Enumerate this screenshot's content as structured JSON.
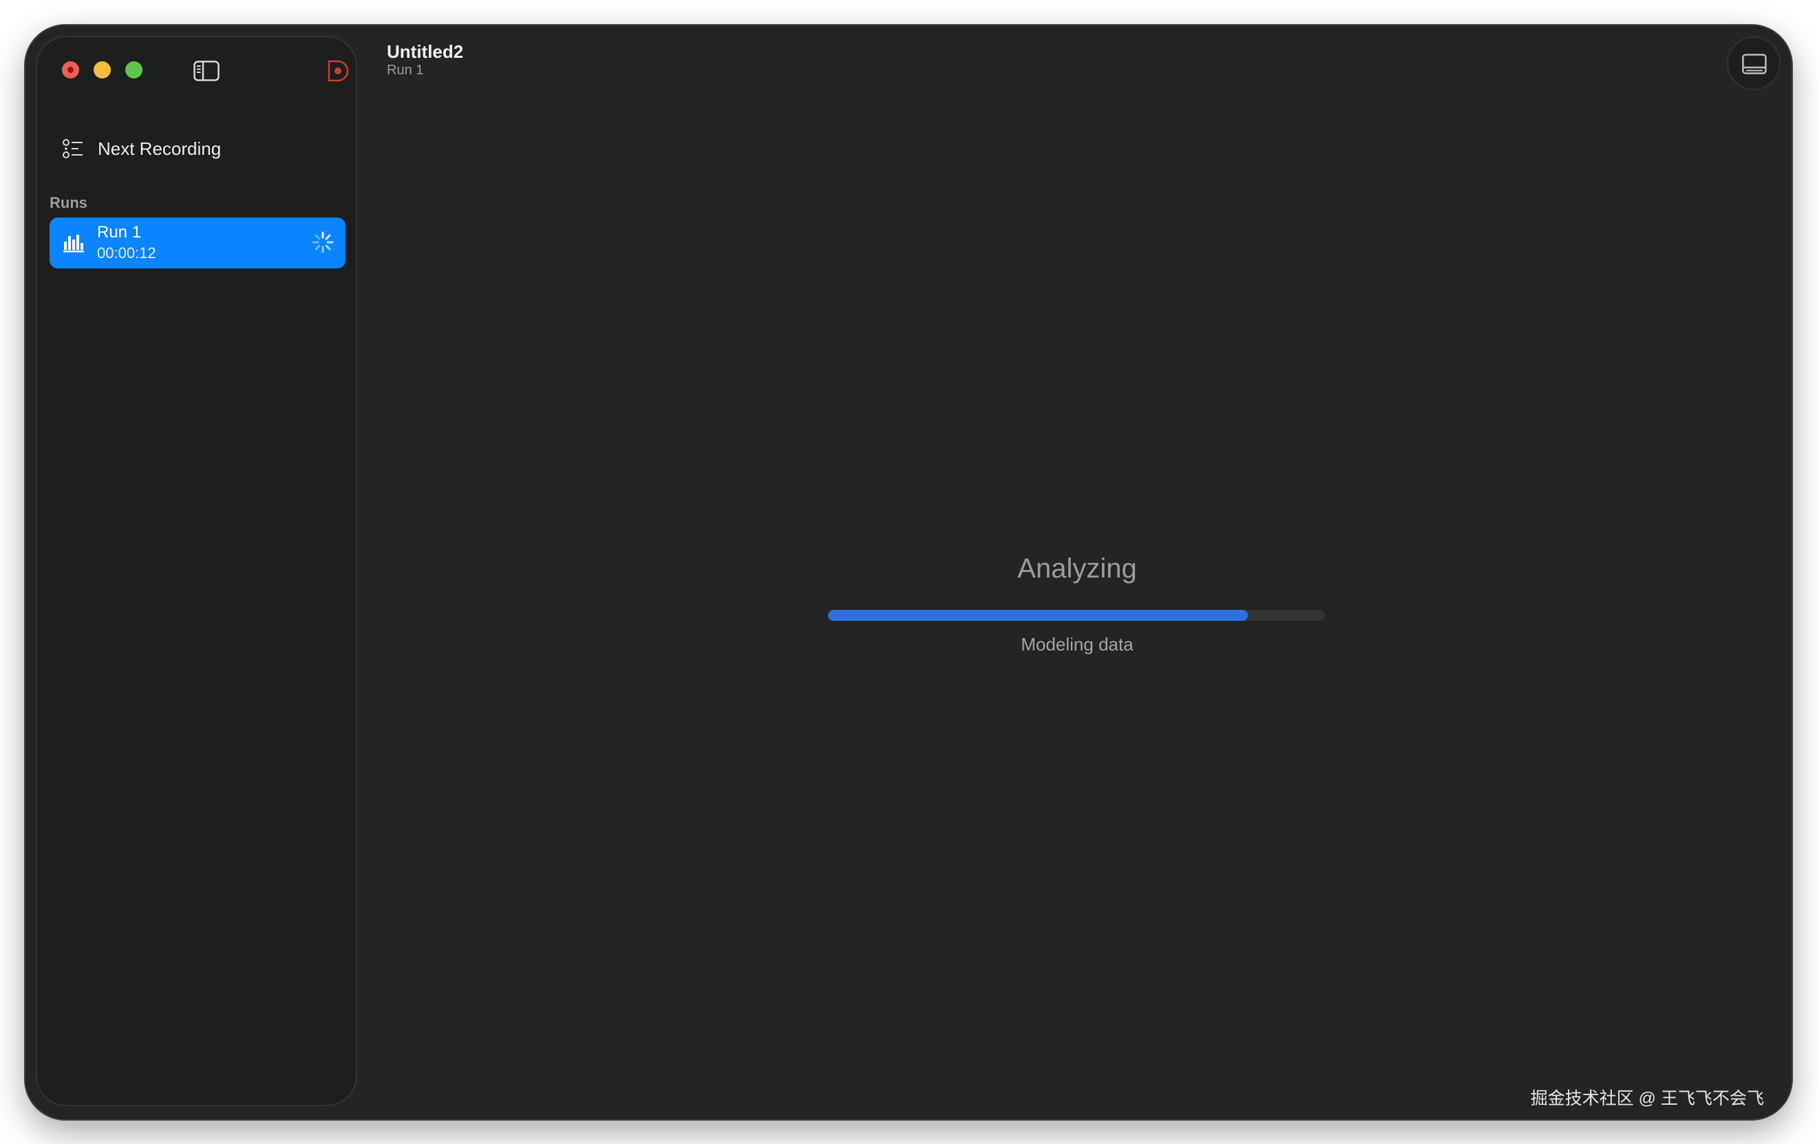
{
  "window": {
    "title": "Untitled2",
    "subtitle": "Run 1"
  },
  "sidebar": {
    "next_recording_label": "Next Recording",
    "section_label": "Runs",
    "runs": [
      {
        "name": "Run 1",
        "duration": "00:00:12",
        "status": "analyzing"
      }
    ]
  },
  "main": {
    "status_title": "Analyzing",
    "progress_label": "Modeling data",
    "progress_fraction": 0.845
  },
  "watermark": "掘金技术社区 @ 王飞飞不会飞",
  "icons": {
    "sidebar_toggle": "sidebar-left-icon",
    "record": "record-icon",
    "next_recording": "list-icon",
    "run": "chart-bars-icon",
    "spinner": "spinner-icon",
    "panel": "bottom-panel-icon"
  },
  "colors": {
    "accent": "#0a84ff",
    "progress": "#2f6fe0",
    "close": "#ec5f57",
    "minimize": "#f4be38",
    "maximize": "#5fc549",
    "record": "#d43a33"
  }
}
